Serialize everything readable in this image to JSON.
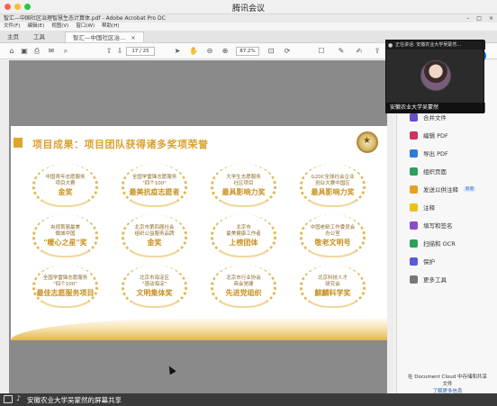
{
  "meeting": {
    "app_title": "腾讯会议",
    "share_label": "安徽农业大学吴蒙然的屏幕共享",
    "speaking_prefix": "正在讲话: 安徽农业大学吴蒙然...",
    "video_name": "安徽农业大学吴蒙然"
  },
  "acrobat": {
    "window_title": "智汇—中国社区治理智慧生态计算体.pdf - Adobe Acrobat Pro DC",
    "menu": [
      "文件(F)",
      "编辑(E)",
      "视图(V)",
      "窗口(W)",
      "帮助(H)"
    ],
    "tabs": {
      "home": "主页",
      "tools": "工具",
      "doc": "智汇—中国社区治...",
      "doc_close": "×"
    },
    "toolbar": {
      "page_current": "17",
      "page_total": "25",
      "page_display": "17  /  25",
      "zoom": "87.2%"
    },
    "right_pane": {
      "tools": [
        {
          "label": "合并文件",
          "color": "#6b4cc9"
        },
        {
          "label": "编辑 PDF",
          "color": "#d1315f"
        },
        {
          "label": "导出 PDF",
          "color": "#2d7bd8"
        },
        {
          "label": "组织页面",
          "color": "#2d9e5f"
        },
        {
          "label": "发送以供注释",
          "color": "#e6a11a",
          "badge": "新增"
        },
        {
          "label": "注释",
          "color": "#e6c21a"
        },
        {
          "label": "填写和签名",
          "color": "#8b4cc9"
        },
        {
          "label": "扫描和 OCR",
          "color": "#2da05a"
        },
        {
          "label": "保护",
          "color": "#5a5ad8"
        },
        {
          "label": "更多工具",
          "color": "#777777"
        }
      ],
      "footer_line1": "在 Document Cloud 中存储和共享",
      "footer_line2": "文件",
      "footer_link": "了解更多信息"
    }
  },
  "slide": {
    "heading": "项目成果：项目团队获得诸多奖项荣誉",
    "awards": [
      {
        "l1": "中国青年志愿服务",
        "l2": "项目大赛",
        "big": "金奖"
      },
      {
        "l1": "全国学雷锋志愿服务",
        "l2": "\"四个100\"",
        "big": "最美抗疫志愿者"
      },
      {
        "l1": "大学生志愿服务",
        "l2": "社区项目",
        "big": "最具影响力奖"
      },
      {
        "l1": "G20C全球社会企业",
        "l2": "创业大赛中国区",
        "big": "最具影响力奖"
      },
      {
        "l1": "央视首届最美",
        "l2": "微城中国",
        "big": "\"暖心之星\"奖"
      },
      {
        "l1": "北京市第四届社会",
        "l2": "组织公益服务品牌",
        "big": "金奖"
      },
      {
        "l1": "北京市",
        "l2": "最美健康工作者",
        "big": "上榜团体"
      },
      {
        "l1": "中国老龄工作委员会",
        "l2": "办公室",
        "big": "敬老文明号"
      },
      {
        "l1": "全国学雷锋志愿服务",
        "l2": "\"四个100\"",
        "big": "最佳志愿服务项目"
      },
      {
        "l1": "北京市海淀区",
        "l2": "\"感动海淀\"",
        "big": "文明集体奖"
      },
      {
        "l1": "北京市行业协会",
        "l2": "商会党建",
        "big": "先进党组织"
      },
      {
        "l1": "北京科技人才",
        "l2": "研究会",
        "big": "麒麟科学奖"
      }
    ]
  },
  "colors": {
    "gold": "#d9a130",
    "acrobat_blue": "#1473e6"
  },
  "icons": [
    "home-icon",
    "save-icon",
    "print-icon",
    "mail-icon",
    "search-icon",
    "prev-page-icon",
    "next-page-icon",
    "cursor-tool-icon",
    "hand-tool-icon",
    "zoom-out-icon",
    "zoom-in-icon",
    "comment-icon",
    "pen-icon",
    "sign-icon",
    "share-icon",
    "mic-icon",
    "screen-share-icon"
  ]
}
